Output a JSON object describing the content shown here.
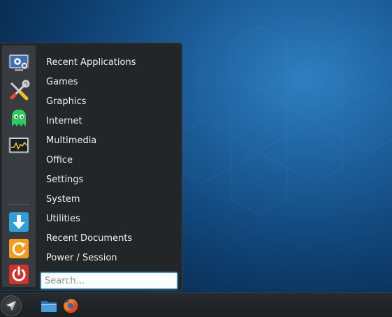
{
  "menu": {
    "categories": [
      "Recent Applications",
      "Games",
      "Graphics",
      "Internet",
      "Multimedia",
      "Office",
      "Settings",
      "System",
      "Utilities",
      "Recent Documents",
      "Power / Session"
    ],
    "favorites": [
      {
        "icon": "system-settings-icon"
      },
      {
        "icon": "tools-icon"
      },
      {
        "icon": "ghost-game-icon"
      },
      {
        "icon": "system-monitor-icon"
      }
    ],
    "actions": [
      {
        "icon": "download-arrow-icon"
      },
      {
        "icon": "update-icon"
      },
      {
        "icon": "power-icon"
      }
    ],
    "search": {
      "placeholder": "Search...",
      "value": ""
    }
  },
  "taskbar": {
    "items": [
      {
        "icon": "application-launcher-icon"
      },
      {
        "icon": "file-manager-icon"
      },
      {
        "icon": "firefox-icon"
      }
    ]
  },
  "colors": {
    "menu_bg": "#232629",
    "sidebar_bg": "#383c40",
    "text": "#eff0f1",
    "search_focus": "#3daee9",
    "taskbar_bg": "#272b2e"
  }
}
